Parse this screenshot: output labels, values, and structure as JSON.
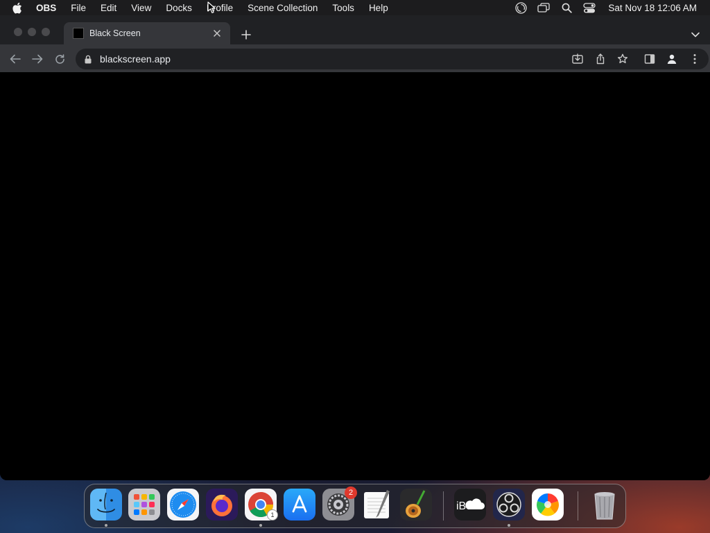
{
  "menubar": {
    "app_name": "OBS",
    "items": [
      "File",
      "Edit",
      "View",
      "Docks",
      "Profile",
      "Scene Collection",
      "Tools",
      "Help"
    ],
    "clock": "Sat Nov 18  12:06 AM",
    "status_icons": [
      "obs-status-icon",
      "screens-icon",
      "search-icon",
      "control-center-icon"
    ]
  },
  "browser": {
    "tab_title": "Black Screen",
    "url": "blackscreen.app",
    "page_background": "#000000"
  },
  "dock": {
    "apps": [
      {
        "name": "Finder",
        "icon": "finder-icon",
        "running": true
      },
      {
        "name": "Launchpad",
        "icon": "launchpad-icon"
      },
      {
        "name": "Safari",
        "icon": "safari-icon"
      },
      {
        "name": "Firefox",
        "icon": "firefox-icon"
      },
      {
        "name": "Google Chrome",
        "icon": "chrome-icon",
        "running": true,
        "badge": "1"
      },
      {
        "name": "App Store",
        "icon": "app-store-icon"
      },
      {
        "name": "System Settings",
        "icon": "settings-icon",
        "badge": "2"
      },
      {
        "name": "TextEdit",
        "icon": "textedit-icon"
      },
      {
        "name": "GarageBand",
        "icon": "garageband-icon"
      },
      {
        "name": "iBoostUp Cloud",
        "icon": "ib-cloud-icon"
      },
      {
        "name": "OBS",
        "icon": "obs-icon",
        "running": true
      },
      {
        "name": "Color Picker",
        "icon": "color-icon"
      },
      {
        "name": "Trash",
        "icon": "trash-icon"
      }
    ],
    "ib_label": "iB"
  },
  "colors": {
    "menubar": "#1c1c1e",
    "tabstrip": "#202124",
    "toolbar": "#35363a",
    "badge": "#e0392d"
  }
}
